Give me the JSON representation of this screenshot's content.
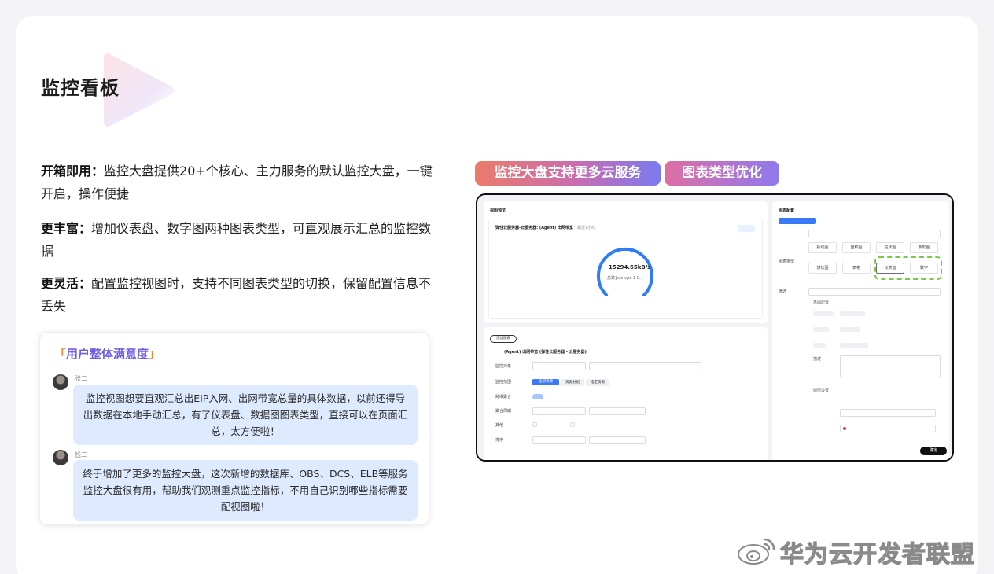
{
  "title": "监控看板",
  "features": [
    {
      "head": "开箱即用：",
      "body": "监控大盘提供20+个核心、主力服务的默认监控大盘，一键开启，操作便捷"
    },
    {
      "head": "更丰富：",
      "body": "增加仪表盘、数字图两种图表类型，可直观展示汇总的监控数据"
    },
    {
      "head": "更灵活：",
      "body": "配置监控视图时，支持不同图表类型的切换，保留配置信息不丢失"
    }
  ],
  "feedback": {
    "title_open": "「",
    "title_text": "用户整体满意度",
    "title_close": "」",
    "comments": [
      {
        "user": "张二",
        "text": "监控视图想要直观汇总出EIP入网、出网带宽总量的具体数据，以前还得导出数据在本地手动汇总，有了仪表盘、数据图图表类型，直接可以在页面汇总，太方便啦！"
      },
      {
        "user": "钱二",
        "text": "终于增加了更多的监控大盘，这次新增的数据库、OBS、DCS、ELB等服务监控大盘很有用，帮助我们观测重点监控指标，不用自己识别哪些指标需要配视图啦！"
      }
    ]
  },
  "tags": [
    "监控大盘支持更多云服务",
    "图表类型优化"
  ],
  "screenshot": {
    "preview_title": "视图预览",
    "chart_title": "弹性云服务器-云服务器: (Agent) 出网带宽",
    "chart_sub": "最近1小时",
    "gauge_value": "15294.65kB/s",
    "gauge_sub": "[总数]ecs-vpc-1-0...",
    "add_btn": "添加图表",
    "section_title": "(Agent) 出网带宽 (弹性云服务器 - 云服务器)",
    "form_labels": [
      "监控对象",
      "监控范围",
      "跨维聚合",
      "聚合周期",
      "其他",
      "排序"
    ],
    "scope_tabs": [
      "全部资源",
      "资源分组",
      "指定资源"
    ],
    "config_title": "图表配置",
    "chart_type_label": "图表类型",
    "chart_types": [
      "折线图",
      "面积图",
      "柱状图",
      "条形图",
      "饼状图",
      "表格",
      "仪表盘",
      "数字"
    ],
    "filter_label": "筛选",
    "basic_label": "基础配置",
    "detail_label": "描述",
    "threshold_label": "阈值设置",
    "confirm_btn": "确定"
  },
  "watermark": "华为云开发者联盟",
  "colors": {
    "accent_blue": "#3a7af6",
    "bubble": "#ddeaff",
    "dashed_highlight": "#7ac943",
    "quote_orange": "#e8882a",
    "quote_purple": "#6f5ce8"
  }
}
